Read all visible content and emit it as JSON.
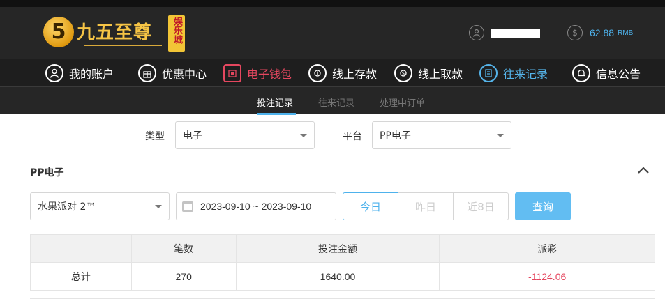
{
  "brand": {
    "logo_digit": "5",
    "name": "九五至尊",
    "tag": "娱乐城"
  },
  "account": {
    "balance": "62.88",
    "currency": "RMB"
  },
  "nav": {
    "items": [
      {
        "label": "我的账户",
        "icon": "user-icon"
      },
      {
        "label": "优惠中心",
        "icon": "gift-icon"
      },
      {
        "label": "电子钱包",
        "icon": "wallet-icon"
      },
      {
        "label": "线上存款",
        "icon": "deposit-icon"
      },
      {
        "label": "线上取款",
        "icon": "withdraw-icon"
      },
      {
        "label": "往来记录",
        "icon": "records-icon"
      },
      {
        "label": "信息公告",
        "icon": "bell-icon"
      }
    ],
    "active_index": 5,
    "highlight_index": 2
  },
  "subnav": {
    "tabs": [
      "投注记录",
      "往来记录",
      "处理中订单"
    ],
    "active_index": 0
  },
  "filters": {
    "type_label": "类型",
    "type_value": "电子",
    "platform_label": "平台",
    "platform_value": "PP电子"
  },
  "section": {
    "title": "PP电子"
  },
  "query": {
    "game_value": "水果派对 2™",
    "date_range": "2023-09-10 ~ 2023-09-10",
    "quick_ranges": [
      "今日",
      "昨日",
      "近8日"
    ],
    "active_range": 0,
    "submit_label": "查询"
  },
  "summary_table": {
    "headers": [
      "",
      "笔数",
      "投注金额",
      "派彩"
    ],
    "rows": [
      {
        "label": "总计",
        "count": "270",
        "bet_amount": "1640.00",
        "payout": "-1124.06"
      }
    ]
  },
  "colors": {
    "accent": "#4eb2ec",
    "negative": "#e5475f",
    "gold": "#f6c445",
    "header_bg": "#262626"
  }
}
